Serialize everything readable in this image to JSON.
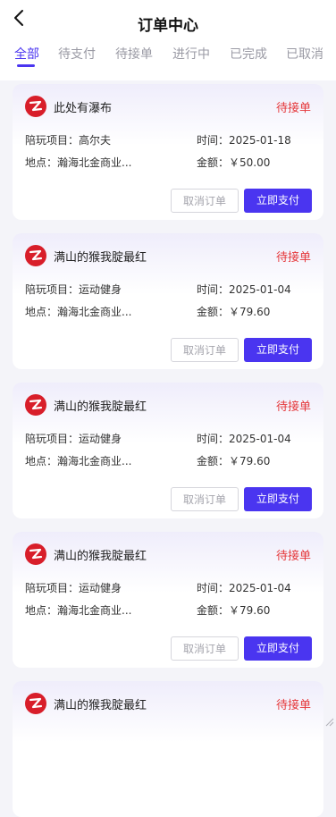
{
  "header": {
    "title": "订单中心"
  },
  "tabs": [
    {
      "label": "全部",
      "active": true
    },
    {
      "label": "待支付",
      "active": false
    },
    {
      "label": "待接单",
      "active": false
    },
    {
      "label": "进行中",
      "active": false
    },
    {
      "label": "已完成",
      "active": false
    },
    {
      "label": "已取消",
      "active": false
    }
  ],
  "colors": {
    "accent": "#4a35f0",
    "status": "#e5383b",
    "logo": "#d81e2a"
  },
  "orders": [
    {
      "name": "此处有瀑布",
      "status": "待接单",
      "project_label": "陪玩项目：高尔夫",
      "time_label": "时间：2025-01-18",
      "place_label": "地点：瀚海北金商业...",
      "amount_label": "金额：￥50.00",
      "cancel_label": "取消订单",
      "pay_label": "立即支付"
    },
    {
      "name": "满山的猴我腚最红",
      "status": "待接单",
      "project_label": "陪玩项目：运动健身",
      "time_label": "时间：2025-01-04",
      "place_label": "地点：瀚海北金商业...",
      "amount_label": "金额：￥79.60",
      "cancel_label": "取消订单",
      "pay_label": "立即支付"
    },
    {
      "name": "满山的猴我腚最红",
      "status": "待接单",
      "project_label": "陪玩项目：运动健身",
      "time_label": "时间：2025-01-04",
      "place_label": "地点：瀚海北金商业...",
      "amount_label": "金额：￥79.60",
      "cancel_label": "取消订单",
      "pay_label": "立即支付"
    },
    {
      "name": "满山的猴我腚最红",
      "status": "待接单",
      "project_label": "陪玩项目：运动健身",
      "time_label": "时间：2025-01-04",
      "place_label": "地点：瀚海北金商业...",
      "amount_label": "金额：￥79.60",
      "cancel_label": "取消订单",
      "pay_label": "立即支付"
    },
    {
      "name": "满山的猴我腚最红",
      "status": "待接单"
    }
  ]
}
